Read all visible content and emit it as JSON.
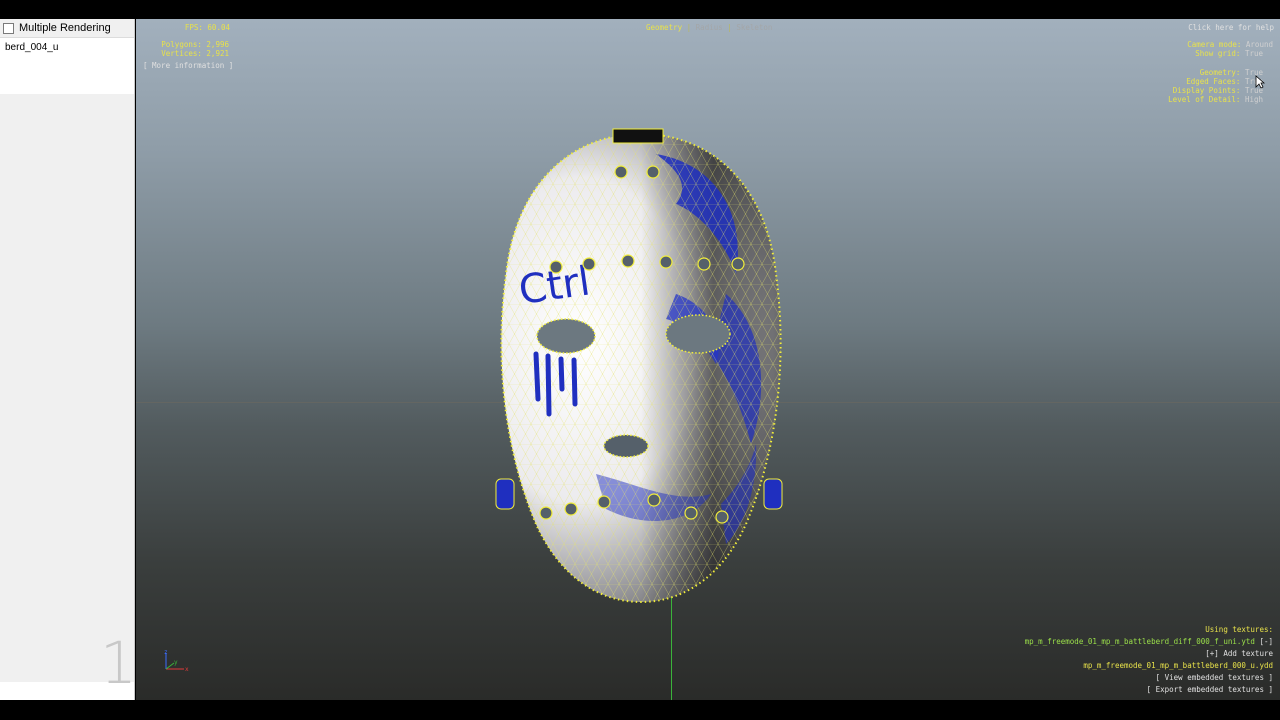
{
  "sidebar": {
    "header_label": "Multiple Rendering",
    "items": [
      {
        "label": "berd_004_u"
      }
    ],
    "slot_number": "1"
  },
  "hud": {
    "fps_label": "FPS:",
    "fps_value": "60.04",
    "polygons_label": "Polygons:",
    "polygons_value": "2,996",
    "vertices_label": "Vertices:",
    "vertices_value": "2,921",
    "more_info": "[ More information ]",
    "modes": [
      "Geometry",
      "Radius",
      "Skeleton"
    ],
    "help": "Click here for help",
    "camera_mode_label": "Camera mode:",
    "camera_mode_value": "Around",
    "show_grid_label": "Show grid:",
    "show_grid_value": "True",
    "geometry_label": "Geometry:",
    "geometry_value": "True",
    "edged_faces_label": "Edged Faces:",
    "edged_faces_value": "True",
    "display_points_label": "Display Points:",
    "display_points_value": "True",
    "lod_label": "Level of Detail:",
    "lod_value": "High"
  },
  "textures": {
    "heading": "Using textures:",
    "diffuse": "mp_m_freemode_01_mp_m_battleberd_diff_000_f_uni.ytd",
    "remove": "[-]",
    "add": "[+] Add texture",
    "model": "mp_m_freemode_01_mp_m_battleberd_000_u.ydd",
    "view_embedded": "[ View embedded textures ]",
    "export_embedded": "[ Export embedded textures ]"
  },
  "mask_graffiti": "Ctrl",
  "axes": {
    "z": "z",
    "y": "y",
    "x": "x"
  },
  "colors": {
    "hud_yellow": "#e8e24a",
    "texture_green": "#9be04a",
    "vertex_yellow": "#f2ee3a",
    "paint_blue": "#1f2fbf",
    "grid_green": "#3ab33a"
  }
}
